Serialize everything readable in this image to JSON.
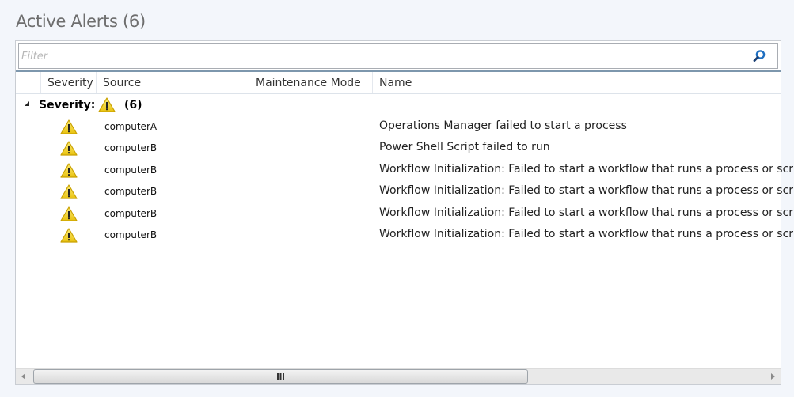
{
  "page": {
    "title": "Active Alerts (6)"
  },
  "filter": {
    "placeholder": "Filter",
    "value": "",
    "search_icon": "search-icon"
  },
  "columns": [
    "Severity",
    "Source",
    "Maintenance Mode",
    "Name"
  ],
  "group": {
    "label": "Severity:",
    "icon": "warning-icon",
    "count": "(6)",
    "expanded": true
  },
  "alerts": [
    {
      "severity": "warning",
      "source": "computerA",
      "maintenance_mode": "",
      "name": "Operations Manager failed to start a process"
    },
    {
      "severity": "warning",
      "source": "computerB",
      "maintenance_mode": "",
      "name": "Power Shell Script failed to run"
    },
    {
      "severity": "warning",
      "source": "computerB",
      "maintenance_mode": "",
      "name": "Workflow Initialization: Failed to start a workflow that runs a process or script"
    },
    {
      "severity": "warning",
      "source": "computerB",
      "maintenance_mode": "",
      "name": "Workflow Initialization: Failed to start a workflow that runs a process or script"
    },
    {
      "severity": "warning",
      "source": "computerB",
      "maintenance_mode": "",
      "name": "Workflow Initialization: Failed to start a workflow that runs a process or script"
    },
    {
      "severity": "warning",
      "source": "computerB",
      "maintenance_mode": "",
      "name": "Workflow Initialization: Failed to start a workflow that runs a process or script"
    }
  ],
  "scrollbar": {
    "grip_label": "III"
  },
  "colors": {
    "warning_fill": "#f2d21d",
    "warning_stroke": "#c9a100",
    "accent": "#1f6fc1"
  }
}
